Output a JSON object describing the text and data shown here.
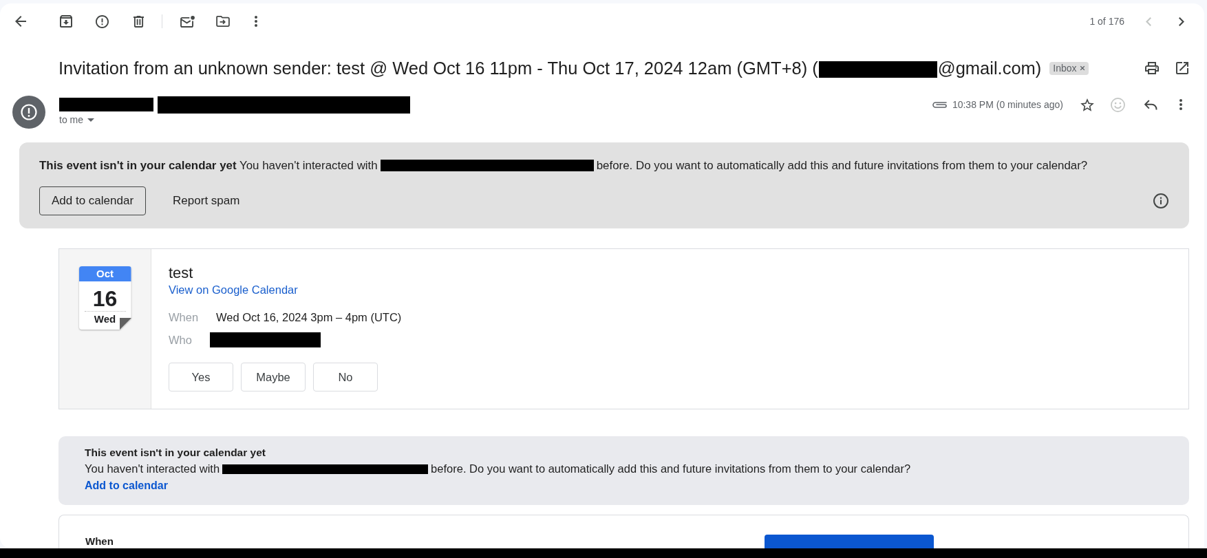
{
  "pager": {
    "count": "1 of 176",
    "prev_disabled": true,
    "next_disabled": false
  },
  "subject": {
    "parts": [
      {
        "kind": "text",
        "text": "Invitation from an unknown sender: test @ Wed Oct 16 11pm - Thu Oct 17, 2024 12am (GMT+8) ("
      },
      {
        "kind": "redacted"
      },
      {
        "kind": "text",
        "text": "@gmail.com)"
      }
    ],
    "label": "Inbox"
  },
  "sender": {
    "parts": [
      {
        "kind": "redacted"
      },
      {
        "kind": "redacted"
      }
    ],
    "recipient": "to me"
  },
  "meta": {
    "has_attachment": true,
    "time": "10:38 PM (0 minutes ago)",
    "starred": false
  },
  "banner": {
    "parts": [
      {
        "kind": "text",
        "text": "**This event isn't in your calendar yet** You haven't interacted with"
      },
      {
        "kind": "redacted"
      },
      {
        "kind": "text",
        "text": "before. Do you want to automatically add this and future invitations from them to your calendar?"
      }
    ],
    "buttons": [
      {
        "label": "Add to calendar",
        "kind": "outlined"
      },
      {
        "label": "Report spam",
        "kind": "text"
      }
    ]
  },
  "event": {
    "date": {
      "month": "Oct",
      "day": "16",
      "weekday": "Wed"
    },
    "title": "test",
    "link": "View on Google Calendar",
    "details": [
      {
        "label": "When",
        "kind": "text",
        "value": "Wed Oct 16, 2024 3pm – 4pm (UTC)"
      },
      {
        "label": "Who",
        "kind": "redacted"
      }
    ],
    "rsvp": [
      {
        "label": "Yes",
        "selected": false
      },
      {
        "label": "Maybe",
        "selected": false
      },
      {
        "label": "No",
        "selected": false
      }
    ]
  },
  "notice": {
    "heading": "This event isn't in your calendar yet",
    "parts": [
      {
        "kind": "text",
        "text": "You haven't interacted with"
      },
      {
        "kind": "redacted"
      },
      {
        "kind": "text",
        "text": "before. Do you want to automatically add this and future invitations from them to your calendar?"
      }
    ],
    "link": "Add to calendar"
  },
  "details_card": {
    "label": "When"
  }
}
